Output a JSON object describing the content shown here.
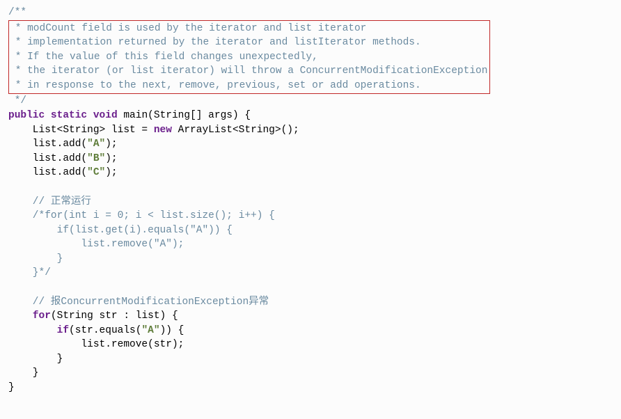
{
  "code": {
    "doc_open": "/**",
    "doc_star": " *",
    "doc_close": " */",
    "doc_l1_pre": " * ",
    "doc_l1": "modCount field is used by the iterator and list iterator",
    "doc_l2": "implementation returned by the iterator and listIterator methods.",
    "doc_l3": "If the value of this field changes unexpectedly,",
    "doc_l4": "the iterator (or list iterator) will throw a ConcurrentModificationException",
    "doc_l5": "in response to the next, remove, previous, set or add operations.",
    "kw_public": "public",
    "kw_static": "static",
    "kw_void": "void",
    "kw_new": "new",
    "kw_for": "for",
    "kw_if": "if",
    "sig_1": " main(String[] args) {",
    "l_list_decl_a": "    List<String> list = ",
    "l_list_decl_b": " ArrayList<String>();",
    "l_add1_a": "    list.add(",
    "l_add1_b": ");",
    "s_A": "\"A\"",
    "s_B": "\"B\"",
    "s_C": "\"C\"",
    "l_empty": "",
    "cmt_ok": "    // 正常运行",
    "cmt_for_open": "    /*for(int i = 0; i < list.size(); i++) {",
    "cmt_for_if": "        if(list.get(i).equals(\"A\")) {",
    "cmt_for_rm": "            list.remove(\"A\");",
    "cmt_for_brace1": "        }",
    "cmt_for_brace2": "    }*/",
    "cmt_err": "    // 报ConcurrentModificationException异常",
    "for2_a": "    ",
    "for2_b": "(String str : list) {",
    "if2_a": "        ",
    "if2_b": "(str.equals(",
    "if2_c": ")) {",
    "rm_line": "            list.remove(str);",
    "brace_c1": "        }",
    "brace_c2": "    }",
    "brace_c3": "}"
  }
}
